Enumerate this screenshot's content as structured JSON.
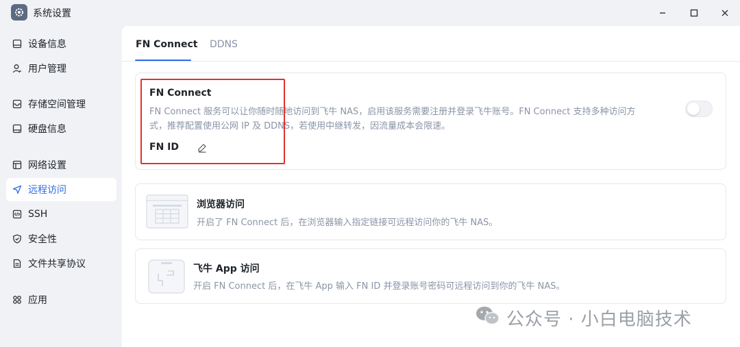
{
  "window": {
    "title": "系统设置",
    "app_icon": "gear-icon",
    "controls": [
      "minimize-icon",
      "maximize-icon",
      "close-icon"
    ]
  },
  "sidebar": {
    "items": [
      {
        "label": "设备信息",
        "icon": "monitor-icon"
      },
      {
        "label": "用户管理",
        "icon": "user-icon"
      },
      {
        "label": "存储空间管理",
        "icon": "storage-icon"
      },
      {
        "label": "硬盘信息",
        "icon": "disk-icon"
      },
      {
        "label": "网络设置",
        "icon": "network-icon"
      },
      {
        "label": "远程访问",
        "icon": "send-icon",
        "active": true
      },
      {
        "label": "SSH",
        "icon": "code-icon"
      },
      {
        "label": "安全性",
        "icon": "shield-icon"
      },
      {
        "label": "文件共享协议",
        "icon": "file-icon"
      },
      {
        "label": "应用",
        "icon": "apps-icon"
      }
    ]
  },
  "tabs": [
    {
      "label": "FN Connect",
      "active": true
    },
    {
      "label": "DDNS",
      "active": false
    }
  ],
  "fn_connect": {
    "title": "FN Connect",
    "description_line1": "FN Connect 服务可以让你随时随地访问到飞牛 NAS，启用该服务需要注册并登录飞牛账号。FN Connect 支持多种访问方",
    "description_line2": "式，推荐配置使用公网 IP 及 DDNS，若使用中继转发，因流量成本会限速。",
    "fn_id_label": "FN ID",
    "edit_icon": "pencil-icon",
    "toggle_enabled": false
  },
  "browser_access": {
    "title": "浏览器访问",
    "description": "开启了 FN Connect 后，在浏览器输入指定链接可远程访问你的飞牛 NAS。",
    "icon": "browser-illustration-icon"
  },
  "app_access": {
    "title": "飞牛 App 访问",
    "description": "开启 FN Connect 后，在飞牛 App 输入 FN ID 并登录账号密码可远程访问到你的飞牛 NAS。",
    "icon": "phone-illustration-icon"
  },
  "watermark": {
    "text": "公众号 · 小白电脑技术",
    "icon": "wechat-icon"
  },
  "colors": {
    "accent": "#2e6be6",
    "highlight": "#e0322b",
    "muted": "#8a94a6",
    "background": "#f0f2f5"
  }
}
